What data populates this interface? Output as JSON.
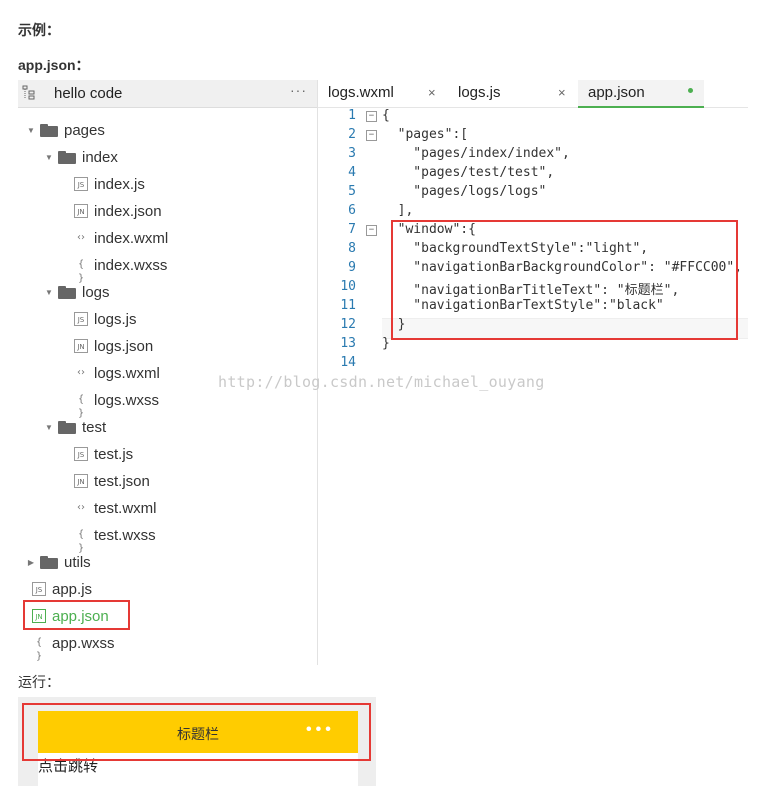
{
  "labels": {
    "example": "示例：",
    "file": "app.json：",
    "run": "运行："
  },
  "tree": {
    "project": "hello code",
    "more": "···",
    "items": [
      {
        "label": "pages",
        "type": "folder",
        "open": true
      },
      {
        "label": "index",
        "type": "folder",
        "open": true
      },
      {
        "label": "index.js",
        "icon": "JS"
      },
      {
        "label": "index.json",
        "icon": "JN"
      },
      {
        "label": "index.wxml",
        "icon": "<>"
      },
      {
        "label": "index.wxss",
        "icon": "{}"
      },
      {
        "label": "logs",
        "type": "folder",
        "open": true
      },
      {
        "label": "logs.js",
        "icon": "JS"
      },
      {
        "label": "logs.json",
        "icon": "JN"
      },
      {
        "label": "logs.wxml",
        "icon": "<>"
      },
      {
        "label": "logs.wxss",
        "icon": "{}"
      },
      {
        "label": "test",
        "type": "folder",
        "open": true
      },
      {
        "label": "test.js",
        "icon": "JS"
      },
      {
        "label": "test.json",
        "icon": "JN"
      },
      {
        "label": "test.wxml",
        "icon": "<>"
      },
      {
        "label": "test.wxss",
        "icon": "{}"
      },
      {
        "label": "utils",
        "type": "folder",
        "open": false
      },
      {
        "label": "app.js",
        "icon": "JS"
      },
      {
        "label": "app.json",
        "icon": "JN",
        "active": true
      },
      {
        "label": "app.wxss",
        "icon": "{}"
      }
    ]
  },
  "tabs": [
    {
      "label": "logs.wxml",
      "close": "×"
    },
    {
      "label": "logs.js",
      "close": "×"
    },
    {
      "label": "app.json",
      "active": true
    }
  ],
  "code": {
    "line_numbers": [
      "1",
      "2",
      "3",
      "4",
      "5",
      "6",
      "7",
      "8",
      "9",
      "10",
      "11",
      "12",
      "13",
      "14"
    ],
    "lines": [
      "{",
      "  \"pages\":[",
      "    \"pages/index/index\",",
      "    \"pages/test/test\",",
      "    \"pages/logs/logs\"",
      "  ],",
      "  \"window\":{",
      "    \"backgroundTextStyle\":\"light\",",
      "    \"navigationBarBackgroundColor\": \"#FFCC00\",",
      "    \"navigationBarTitleText\": \"标题栏\",",
      "    \"navigationBarTextStyle\":\"black\"",
      "  }",
      "}",
      ""
    ]
  },
  "watermark": "http://blog.csdn.net/michael_ouyang",
  "preview": {
    "nav_title": "标题栏",
    "nav_dots": "•••",
    "body_text": "点击跳转",
    "nav_color": "#FFCC00"
  },
  "colors": {
    "accent": "#4caf50",
    "highlight": "#e53935"
  }
}
